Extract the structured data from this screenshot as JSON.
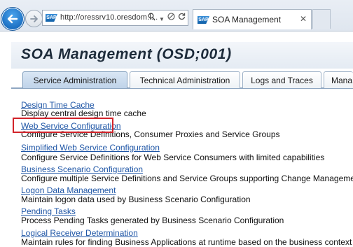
{
  "browser": {
    "url": "http://oressrv10.oresdom.l...",
    "tab_title": "SOA Management",
    "icons": [
      "back-arrow-icon",
      "forward-arrow-icon",
      "search-icon",
      "dropdown-icon",
      "stop-icon",
      "refresh-icon",
      "close-icon"
    ]
  },
  "page": {
    "title": "SOA Management (OSD;001)"
  },
  "tabs": [
    {
      "label": "Service Administration",
      "active": true
    },
    {
      "label": "Technical Administration",
      "active": false
    },
    {
      "label": "Logs and Traces",
      "active": false
    },
    {
      "label": "Mana",
      "active": false
    }
  ],
  "services": [
    {
      "link": "Design Time Cache",
      "description": "Display central design time cache"
    },
    {
      "link": "Web Service Configuration",
      "description": "Configure Service Definitions, Consumer Proxies and Service Groups"
    },
    {
      "link": "Simplified Web Service Configuration",
      "description": "Configure Service Definitions for Web Service Consumers with limited capabilities"
    },
    {
      "link": "Business Scenario Configuration",
      "description": "Configure multiple Service Definitions and Service Groups supporting Change Management"
    },
    {
      "link": "Logon Data Management",
      "description": "Maintain logon data used by Business Scenario Configuration"
    },
    {
      "link": "Pending Tasks",
      "description": "Process Pending Tasks generated by Business Scenario Configuration"
    },
    {
      "link": "Logical Receiver Determination",
      "description": "Maintain rules for finding Business Applications at runtime based on the business context"
    }
  ],
  "colors": {
    "link": "#1f56a6",
    "highlight": "#d2232a",
    "tab_active": "#bfd3e9"
  }
}
